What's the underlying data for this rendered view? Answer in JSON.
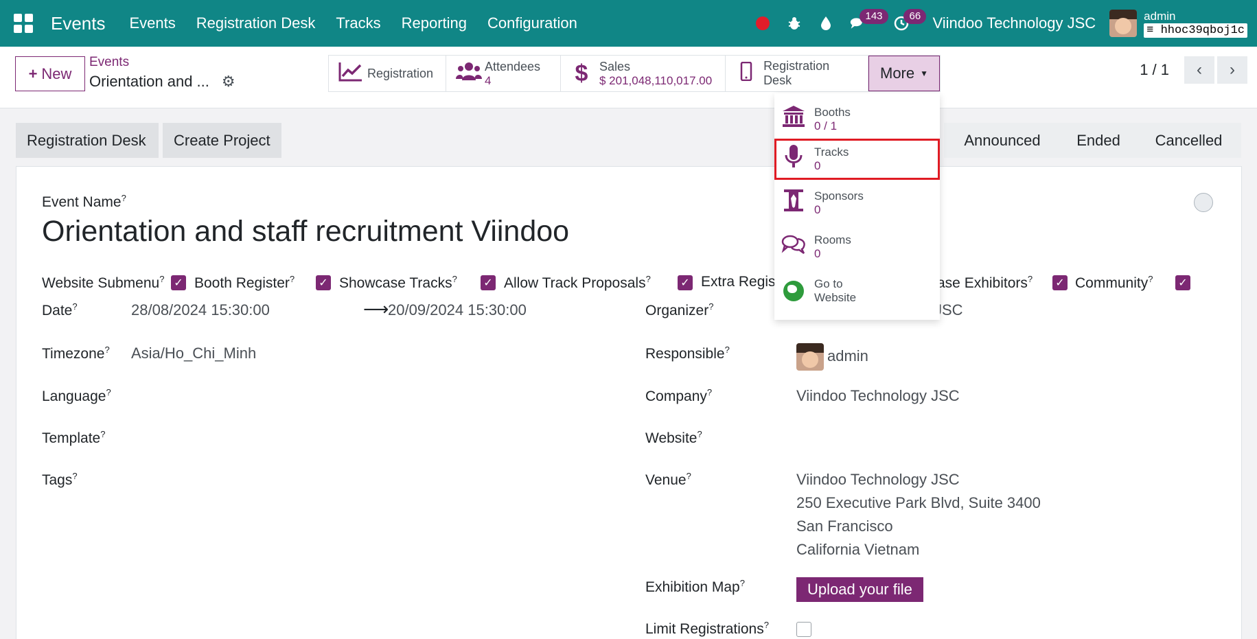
{
  "navbar": {
    "brand": "Events",
    "menu": [
      "Events",
      "Registration Desk",
      "Tracks",
      "Reporting",
      "Configuration"
    ],
    "messages_count": "143",
    "activities_count": "66",
    "company": "Viindoo Technology JSC",
    "user": "admin",
    "database": "hhoc39qboj1c"
  },
  "control": {
    "new_label": "New",
    "breadcrumb_parent": "Events",
    "breadcrumb_current": "Orientation and ...",
    "smart_buttons": {
      "registration": {
        "label": "Registration"
      },
      "attendees": {
        "label": "Attendees",
        "value": "4"
      },
      "sales": {
        "label": "Sales",
        "value": "$ 201,048,110,017.00"
      },
      "registration_desk": {
        "label": "Registration Desk"
      },
      "more": {
        "label": "More"
      }
    },
    "pager": "1 / 1"
  },
  "statusbar": {
    "buttons": [
      "Registration Desk",
      "Create Project"
    ],
    "stages": [
      "Announced",
      "Ended",
      "Cancelled"
    ]
  },
  "form": {
    "event_name_label": "Event Name",
    "event_name": "Orientation and staff recruitment Viindoo",
    "checkbox_labels": [
      "Website Submenu",
      "Booth Register",
      "Showcase Tracks",
      "Allow Track Proposals",
      "Extra Regis",
      "ase Exhibitors",
      "Community"
    ],
    "date_label": "Date",
    "date_start": "28/08/2024 15:30:00",
    "date_end": "20/09/2024 15:30:00",
    "timezone_label": "Timezone",
    "timezone": "Asia/Ho_Chi_Minh",
    "language_label": "Language",
    "template_label": "Template",
    "tags_label": "Tags",
    "organizer_label": "Organizer",
    "organizer_partial": "JSC",
    "responsible_label": "Responsible",
    "responsible": "admin",
    "company_label": "Company",
    "company": "Viindoo Technology JSC",
    "website_label": "Website",
    "venue_label": "Venue",
    "venue_lines": [
      "Viindoo Technology JSC",
      "250 Executive Park Blvd, Suite 3400",
      "San Francisco",
      "California Vietnam"
    ],
    "exhibition_map_label": "Exhibition Map",
    "upload_label": "Upload your file",
    "limit_registrations_label": "Limit Registrations"
  },
  "dropdown": {
    "items": [
      {
        "label": "Booths",
        "value": "0 / 1",
        "icon": "booth-icon"
      },
      {
        "label": "Tracks",
        "value": "0",
        "icon": "microphone-icon"
      },
      {
        "label": "Sponsors",
        "value": "0",
        "icon": "sponsor-icon"
      },
      {
        "label": "Rooms",
        "value": "0",
        "icon": "rooms-icon"
      },
      {
        "label": "Go to",
        "value": "Website",
        "icon": "globe-icon"
      }
    ]
  },
  "colors": {
    "navbar": "#108686",
    "primary": "#7c2873",
    "highlight": "#e01b24"
  }
}
